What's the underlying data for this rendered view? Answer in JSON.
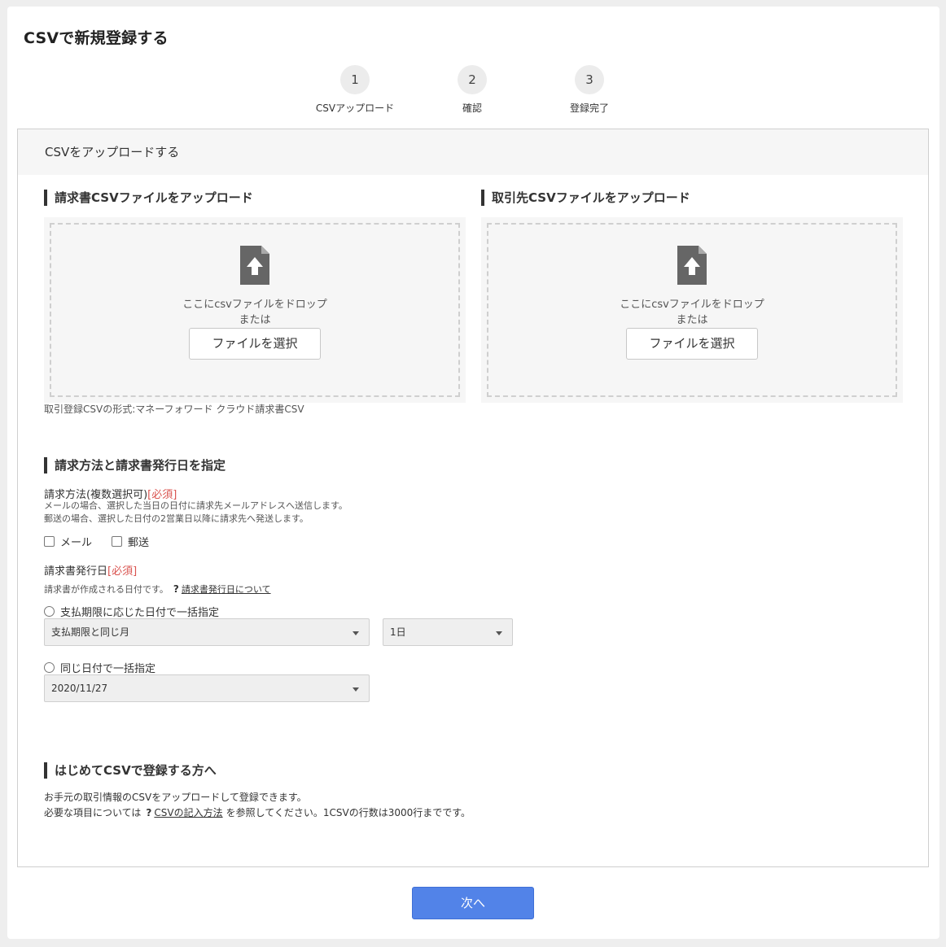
{
  "page": {
    "title": "CSVで新規登録する"
  },
  "steps": [
    {
      "number": "1",
      "label": "CSVアップロード"
    },
    {
      "number": "2",
      "label": "確認"
    },
    {
      "number": "3",
      "label": "登録完了"
    }
  ],
  "panel": {
    "header": "CSVをアップロードする"
  },
  "upload": {
    "invoice": {
      "title": "請求書CSVファイルをアップロード",
      "drop_text": "ここにcsvファイルをドロップ",
      "or_text": "または",
      "button_label": "ファイルを選択"
    },
    "partner": {
      "title": "取引先CSVファイルをアップロード",
      "drop_text": "ここにcsvファイルをドロップ",
      "or_text": "または",
      "button_label": "ファイルを選択"
    },
    "format_note": "取引登録CSVの形式:マネーフォワード クラウド請求書CSV"
  },
  "billing": {
    "section_title": "請求方法と請求書発行日を指定",
    "method_label": "請求方法(複数選択可)",
    "required": "[必須]",
    "method_help_1": "メールの場合、選択した当日の日付に請求先メールアドレスへ送信します。",
    "method_help_2": "郵送の場合、選択した日付の2営業日以降に請求先へ発送します。",
    "options": [
      "メール",
      "郵送"
    ],
    "date_label": "請求書発行日",
    "date_help": "請求書が作成される日付です。",
    "help_q": "?",
    "date_help_link": "請求書発行日について",
    "radio_1": "支払期限に応じた日付で一括指定",
    "select_month": "支払期限と同じ月",
    "select_day": "1日",
    "radio_2": "同じ日付で一括指定",
    "select_date": "2020/11/27"
  },
  "intro": {
    "section_title": "はじめてCSVで登録する方へ",
    "line_1": "お手元の取引情報のCSVをアップロードして登録できます。",
    "line_2_prefix": "必要な項目については",
    "help_q": "?",
    "line_2_link": "CSVの記入方法",
    "line_2_suffix": "を参照してください。1CSVの行数は3000行までです。"
  },
  "footer": {
    "next_label": "次へ"
  },
  "colors": {
    "primary": "#5283e8",
    "required": "#d9534f",
    "step_circle": "#ececec"
  },
  "icons": {
    "file_upload": "file-upload-icon"
  }
}
